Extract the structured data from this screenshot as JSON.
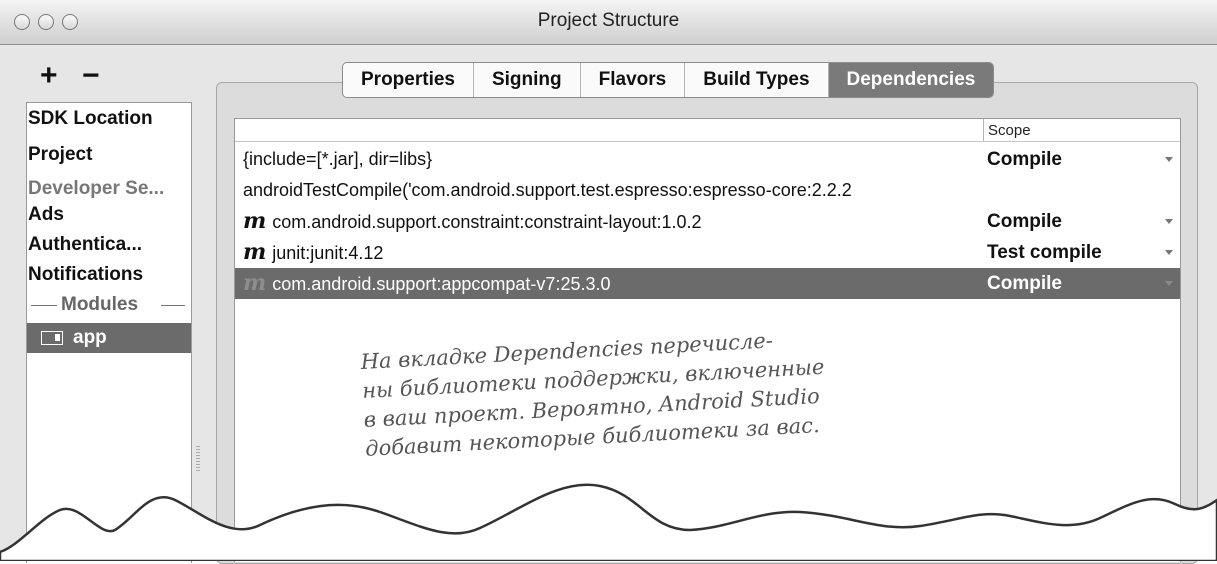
{
  "window": {
    "title": "Project Structure"
  },
  "toolbar": {
    "add_label": "+",
    "remove_label": "−"
  },
  "sidebar": {
    "items": [
      {
        "label": "SDK Location"
      },
      {
        "label": "Project"
      },
      {
        "label": "Developer Se..."
      },
      {
        "label": "Ads"
      },
      {
        "label": "Authentica..."
      },
      {
        "label": "Notifications"
      }
    ],
    "modules_label": "Modules",
    "selected_module": "app"
  },
  "tabs": [
    {
      "label": "Properties"
    },
    {
      "label": "Signing"
    },
    {
      "label": "Flavors"
    },
    {
      "label": "Build Types"
    },
    {
      "label": "Dependencies",
      "active": true
    }
  ],
  "table": {
    "scope_header": "Scope",
    "module_marker": "m",
    "rows": [
      {
        "dependency": "{include=[*.jar], dir=libs}",
        "scope": "Compile"
      },
      {
        "dependency": "androidTestCompile('com.android.support.test.espresso:espresso-core:2.2.2",
        "scope": ""
      },
      {
        "dependency": "com.android.support.constraint:constraint-layout:1.0.2",
        "scope": "Compile"
      },
      {
        "dependency": "junit:junit:4.12",
        "scope": "Test compile"
      },
      {
        "dependency": "com.android.support:appcompat-v7:25.3.0",
        "scope": "Compile",
        "selected": true
      }
    ]
  },
  "annotation": {
    "lines": [
      "На вкладке Dependencies перечисле-",
      "ны библиотеки поддержки, включенные",
      "в ваш проект. Вероятно, Android Studio",
      "добавит некоторые библиотеки за вас."
    ]
  },
  "colors": {
    "selection": "#6b6b6b",
    "active_tab": "#7a7a7a"
  }
}
